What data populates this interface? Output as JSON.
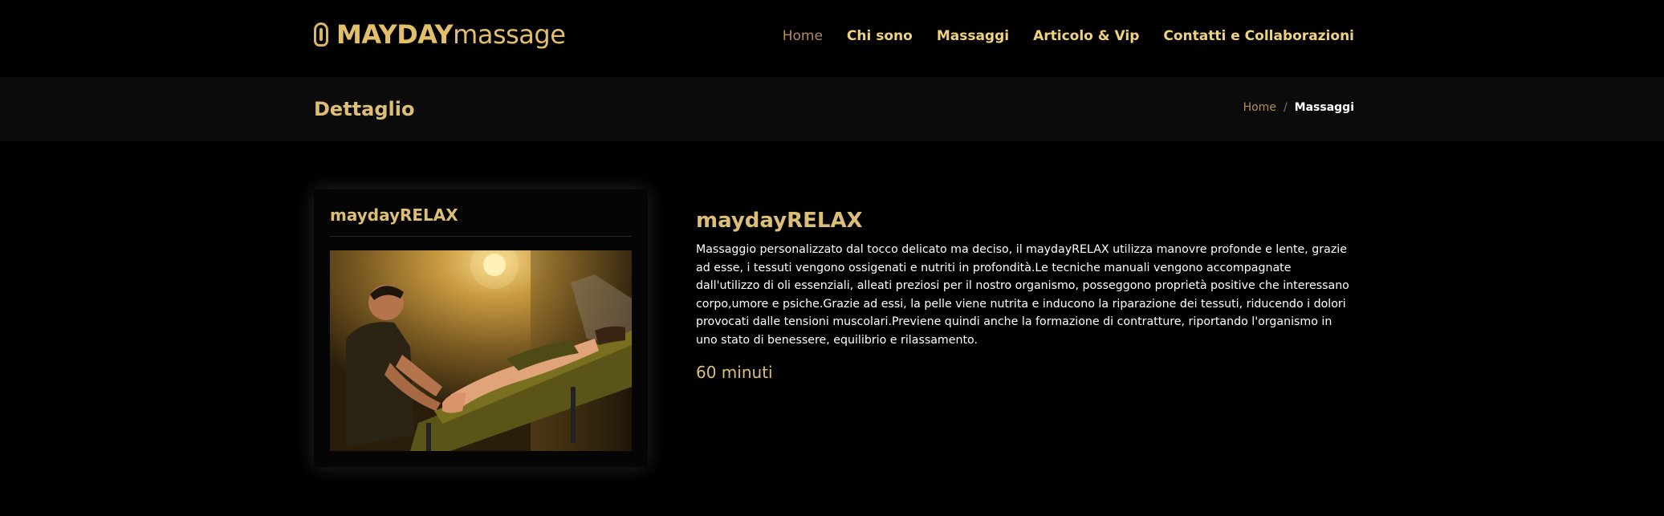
{
  "header": {
    "logo_bold": "MAYDAY",
    "logo_light": "massage",
    "nav": [
      {
        "label": "Home",
        "active": true
      },
      {
        "label": "Chi sono",
        "active": false
      },
      {
        "label": "Massaggi",
        "active": false
      },
      {
        "label": "Articolo & Vip",
        "active": false
      },
      {
        "label": "Contatti e Collaborazioni",
        "active": false
      }
    ]
  },
  "page_band": {
    "title": "Dettaglio",
    "breadcrumb": {
      "home": "Home",
      "separator": "/",
      "current": "Massaggi"
    }
  },
  "card": {
    "title": "maydayRELAX",
    "image": "massage-photo"
  },
  "detail": {
    "title": "maydayRELAX",
    "description": "Massaggio personalizzato dal tocco delicato ma deciso, il maydayRELAX utilizza manovre profonde e lente, grazie ad esse, i tessuti vengono ossigenati e nutriti in profondità.Le tecniche manuali vengono accompagnate dall'utilizzo di oli essenziali, alleati preziosi per il nostro organismo, posseggono proprietà positive che interessano corpo,umore e psiche.Grazie ad essi, la pelle viene nutrita e inducono la riparazione dei tessuti, riducendo i dolori provocati dalle tensioni muscolari.Previene quindi anche la formazione di contratture, riportando l'organismo in uno stato di benessere, equilibrio e rilassamento.",
    "duration": "60 minuti"
  },
  "colors": {
    "background": "#000000",
    "band": "#0b0b0b",
    "gold": "#dcbf75",
    "nav_active": "#b48a5a"
  }
}
